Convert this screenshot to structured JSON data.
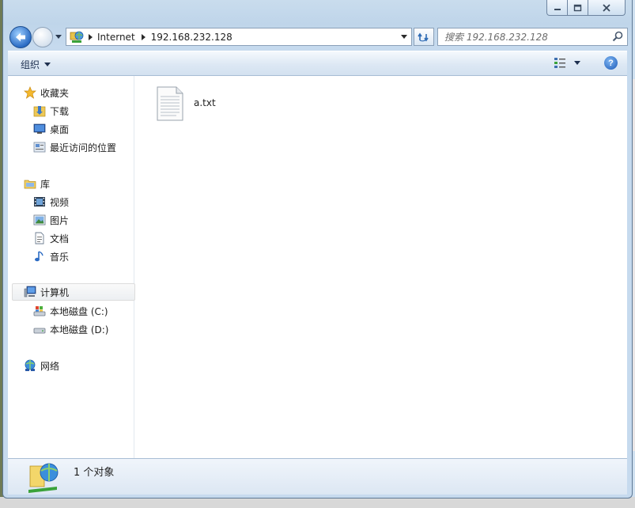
{
  "window": {
    "caption_min": "–",
    "caption_max": "□",
    "caption_close": "✕"
  },
  "address_bar": {
    "breadcrumbs": [
      "Internet",
      "192.168.232.128"
    ]
  },
  "search": {
    "placeholder": "搜索 192.168.232.128"
  },
  "toolbar": {
    "organize_label": "组织",
    "help_label": "?"
  },
  "nav": {
    "favorites": {
      "label": "收藏夹",
      "items": [
        "下载",
        "桌面",
        "最近访问的位置"
      ]
    },
    "libraries": {
      "label": "库",
      "items": [
        "视频",
        "图片",
        "文档",
        "音乐"
      ]
    },
    "computer": {
      "label": "计算机",
      "items": [
        "本地磁盘 (C:)",
        "本地磁盘 (D:)"
      ]
    },
    "network": {
      "label": "网络"
    }
  },
  "files": [
    {
      "name": "a.txt",
      "icon": "text-file-icon"
    }
  ],
  "status": {
    "count_text": "1 个对象"
  }
}
